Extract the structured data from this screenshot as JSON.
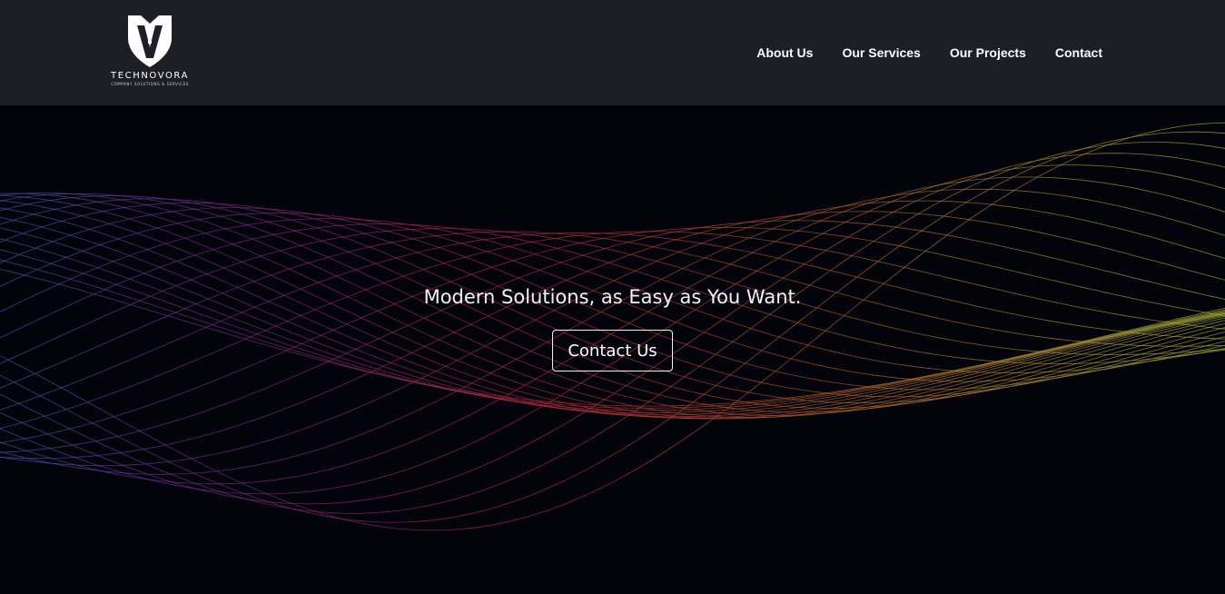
{
  "header": {
    "brand": {
      "name": "TECHNOVORA",
      "tagline": "COMPANY SOLUTIONS & SERVICES",
      "icon": "v-shield-logo-icon"
    },
    "nav": [
      {
        "label": "About Us"
      },
      {
        "label": "Our Services"
      },
      {
        "label": "Our Projects"
      },
      {
        "label": "Contact"
      }
    ]
  },
  "hero": {
    "title": "Modern Solutions, as Easy as You Want.",
    "button_label": "Contact Us"
  },
  "colors": {
    "background": "#03030c",
    "header_background": "#1e1f28",
    "wave_blue": "#4d55a8",
    "wave_purple": "#7a2b8a",
    "wave_red": "#b82b3c",
    "wave_orange": "#b25a2a",
    "wave_olive": "#a6b03a",
    "text": "#ffffff"
  }
}
